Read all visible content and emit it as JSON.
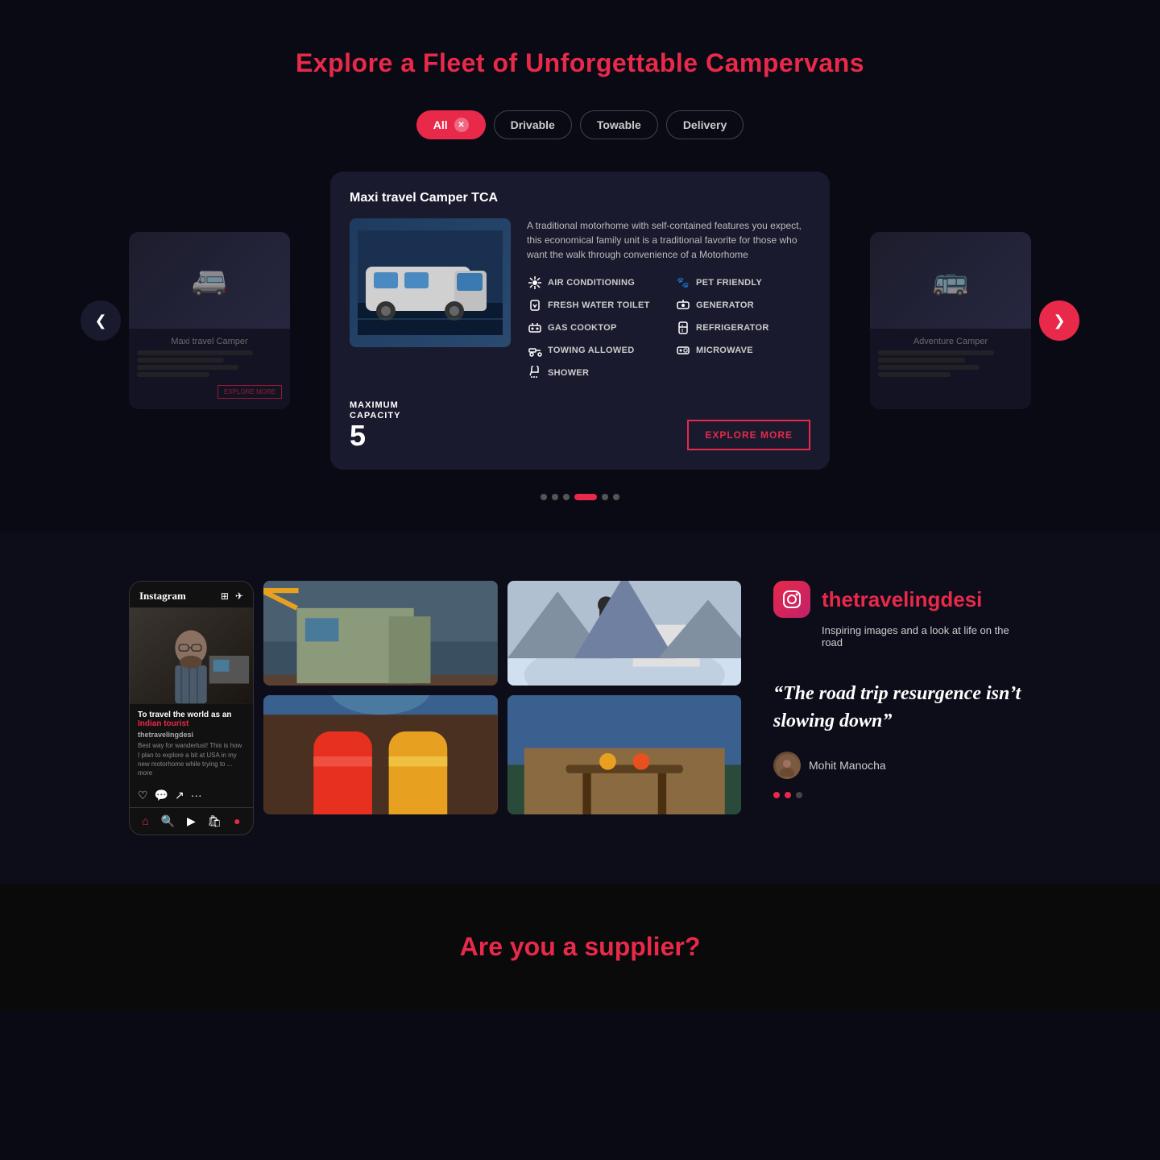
{
  "page": {
    "background": "#0a0a14"
  },
  "fleet": {
    "title": "Explore a Fleet of Unforgettable Campervans",
    "filters": [
      {
        "id": "all",
        "label": "All",
        "active": true
      },
      {
        "id": "drivable",
        "label": "Drivable",
        "active": false
      },
      {
        "id": "towable",
        "label": "Towable",
        "active": false
      },
      {
        "id": "delivery",
        "label": "Delivery",
        "active": false
      }
    ],
    "card": {
      "title": "Maxi travel Camper TCA",
      "description": "A traditional motorhome with self-contained features you expect, this economical family unit is a traditional favorite for those who want the walk through convenience of a Motorhome",
      "features_left": [
        {
          "id": "air-conditioning",
          "label": "AIR CONDITIONING",
          "icon": "❄"
        },
        {
          "id": "fresh-water-toilet",
          "label": "FRESH WATER TOILET",
          "icon": "🚿"
        },
        {
          "id": "gas-cooktop",
          "label": "GAS COOKTOP",
          "icon": "🔥"
        },
        {
          "id": "towing-allowed",
          "label": "TOWING ALLOWED",
          "icon": "🔗"
        },
        {
          "id": "shower",
          "label": "SHOWER",
          "icon": "🚿"
        }
      ],
      "features_right": [
        {
          "id": "pet-friendly",
          "label": "PET FRIENDLY",
          "icon": "🐾"
        },
        {
          "id": "generator",
          "label": "GENERATOR",
          "icon": "⚡"
        },
        {
          "id": "refrigerator",
          "label": "REFRIGERATOR",
          "icon": "🧊"
        },
        {
          "id": "microwave",
          "label": "MICROWAVE",
          "icon": "📡"
        }
      ],
      "capacity_label": "MAXIMUM\nCAPACITY",
      "capacity_number": "5",
      "explore_btn": "EXPLORE MORE"
    },
    "dots": [
      {
        "active": false
      },
      {
        "active": false
      },
      {
        "active": false
      },
      {
        "active": true
      },
      {
        "active": false
      },
      {
        "active": false
      }
    ]
  },
  "instagram": {
    "phone": {
      "logo": "Instagram",
      "caption_title": "To travel the world as an Indian tourist",
      "account": "thetravelingdesi",
      "desc": "Best way for wanderlust! This is how I plan to explore a bit at USA in my new motorhome while trying to ... more"
    },
    "handle": "thetravelingdesi",
    "subtitle": "Inspiring images and a look at life on the road",
    "quote": "“The road trip resurgence isn’t slowing down”",
    "author": "Mohit Manocha"
  },
  "supplier": {
    "title": "Are you a supplier?"
  }
}
